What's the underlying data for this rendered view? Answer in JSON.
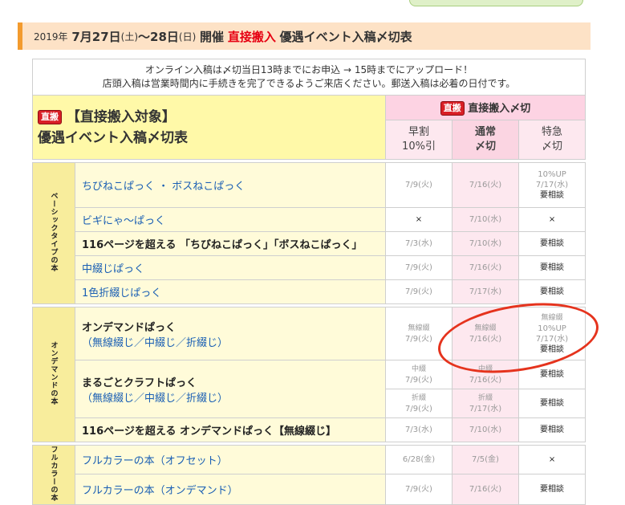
{
  "title": {
    "year": "2019年",
    "dates": "7月27日",
    "sat": "(土)",
    "tilde28": "〜28日",
    "sun": "(日)",
    "kaisai": "開催",
    "direct": "直接搬入",
    "rest": "優遇イベント入稿〆切表"
  },
  "notice": {
    "line1": "オンライン入稿は〆切当日13時までにお申込 → 15時までにアップロード！",
    "line2": "店頭入稿は営業時間内に手続きを完了できるようご来店ください。郵送入稿は必着の日付です。"
  },
  "header": {
    "badge": "直搬",
    "left_line1": "【直接搬入対象】",
    "left_line2": "優遇イベント入稿〆切表",
    "right_title": "直接搬入〆切",
    "col1_l1": "早割",
    "col1_l2": "10%引",
    "col2_l1": "通常",
    "col2_l2": "〆切",
    "col3_l1": "特急",
    "col3_l2": "〆切"
  },
  "categories": {
    "basic": "ベーシックタイプの本",
    "ondemand": "オンデマンドの本",
    "fullcolor": "フルカラーの本"
  },
  "rows": {
    "r1": {
      "name": "ちびねこぱっく ・ ボスねこぱっく",
      "early": "7/9(火)",
      "normal": "7/16(火)",
      "exp1": "10%UP",
      "exp2": "7/17(水)",
      "exp3": "要相談"
    },
    "r2": {
      "name": "ビギにゃ〜ぱっく",
      "early": "×",
      "normal": "7/10(水)",
      "exp": "×"
    },
    "r3": {
      "name": "116ページを超える 「ちびねこぱっく」「ボスねこぱっく」",
      "early": "7/3(水)",
      "normal": "7/10(水)",
      "exp": "要相談"
    },
    "r4": {
      "name": "中綴じぱっく",
      "early": "7/9(火)",
      "normal": "7/16(火)",
      "exp": "要相談"
    },
    "r5": {
      "name": "1色折綴じぱっく",
      "early": "7/9(火)",
      "normal": "7/17(水)",
      "exp": "要相談"
    },
    "r6": {
      "name": "オンデマンドぱっく",
      "sub": "（無線綴じ／中綴じ／折綴じ）",
      "label": "無線綴",
      "early": "7/9(火)",
      "normal": "7/16(火)",
      "exp1": "10%UP",
      "exp2": "7/17(水)",
      "exp3": "要相談"
    },
    "r7": {
      "name": "まるごとクラフトぱっく",
      "sub": "（無線綴じ／中綴じ／折綴じ）",
      "label": "中綴",
      "early": "7/9(火)",
      "normal": "7/16(火)",
      "exp": "要相談"
    },
    "r8": {
      "label": "折綴",
      "early": "7/9(火)",
      "normal": "7/17(水)",
      "exp": "要相談"
    },
    "r9": {
      "name": "116ページを超える オンデマンドぱっく【無線綴じ】",
      "early": "7/3(水)",
      "normal": "7/10(水)",
      "exp": "要相談"
    },
    "r10": {
      "name": "フルカラーの本（オフセット）",
      "early": "6/28(金)",
      "normal": "7/5(金)",
      "exp": "×"
    },
    "r11": {
      "name": "フルカラーの本（オンデマンド）",
      "early": "7/9(火)",
      "normal": "7/16(火)",
      "exp": "要相談"
    }
  },
  "colors": {
    "accent": "#e60012",
    "circle": "#e5331d",
    "link": "#1a5fb4"
  }
}
